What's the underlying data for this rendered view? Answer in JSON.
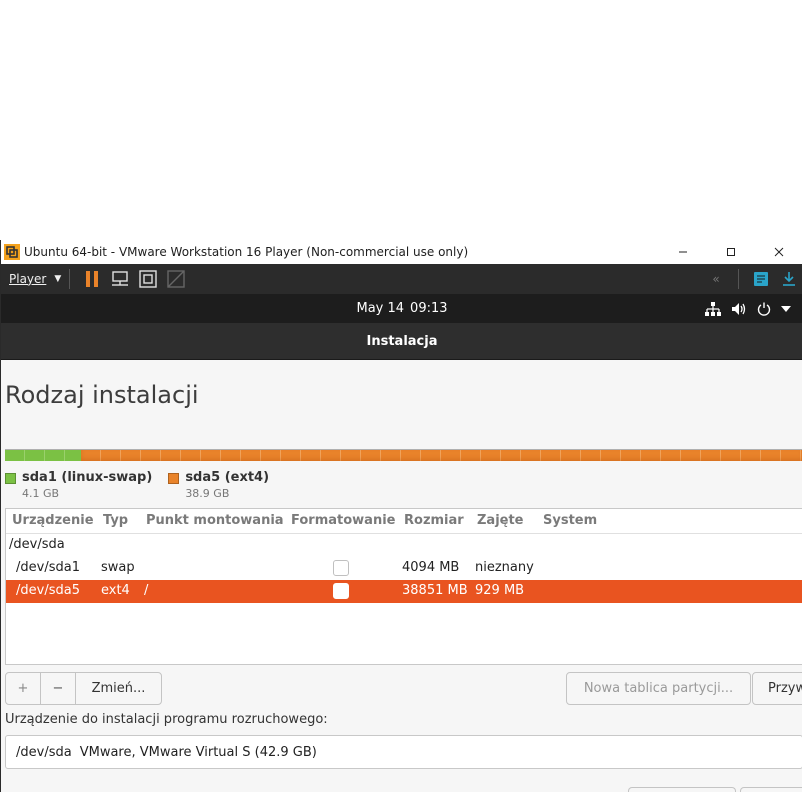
{
  "window": {
    "title": "Ubuntu 64-bit - VMware Workstation 16 Player (Non-commercial use only)",
    "controls": [
      "–",
      "☐",
      "✕"
    ]
  },
  "toolbar": {
    "player_label": "Player",
    "pause_color": "#e9832a"
  },
  "topbar": {
    "date": "May 14",
    "time": "09:13"
  },
  "headerbar": {
    "title": "Instalacja"
  },
  "page": {
    "title": "Rodzaj instalacji"
  },
  "partition_bar": {
    "swap_fraction": 0.0952,
    "swap_color": "#7bc144",
    "ext4_color": "#e9832a"
  },
  "legend": [
    {
      "name": "sda1 (linux-swap)",
      "size": "4.1 GB",
      "color": "#7bc144"
    },
    {
      "name": "sda5 (ext4)",
      "size": "38.9 GB",
      "color": "#e9832a"
    }
  ],
  "table": {
    "columns": [
      "Urządzenie",
      "Typ",
      "Punkt montowania",
      "Formatowanie",
      "Rozmiar",
      "Zajęte",
      "System"
    ],
    "rows": [
      {
        "device": "/dev/sda",
        "type": "",
        "mount": "",
        "format": null,
        "size": "",
        "used": "",
        "system": ""
      },
      {
        "device": "/dev/sda1",
        "type": "swap",
        "mount": "",
        "format": false,
        "size": "4094 MB",
        "used": "nieznany",
        "system": ""
      },
      {
        "device": "/dev/sda5",
        "type": "ext4",
        "mount": "/",
        "format": false,
        "size": "38851 MB",
        "used": "929 MB",
        "system": "",
        "selected": true
      }
    ],
    "selection_color": "#e95420"
  },
  "buttons": {
    "add": "+",
    "remove": "−",
    "change": "Zmień...",
    "new_table": "Nowa tablica partycji...",
    "revert": "Przyw"
  },
  "bootloader": {
    "label": "Urządzenie do instalacji programu rozruchowego:",
    "device": "/dev/sda",
    "description": "VMware, VMware Virtual S (42.9 GB)"
  }
}
